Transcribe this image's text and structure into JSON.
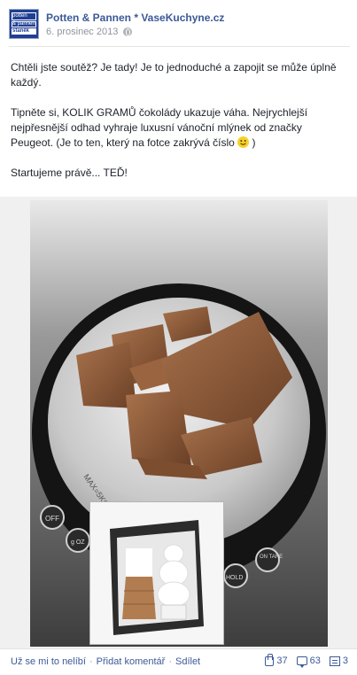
{
  "post": {
    "author": "Potten & Pannen * VaseKuchyne.cz",
    "date": "6. prosinec 2013",
    "privacy_icon": "globe-icon",
    "avatar_text": {
      "line1": "potten",
      "line2": "& pannen",
      "line3": "staněk"
    },
    "paragraphs": [
      "Chtěli jste soutěž? Je tady! Je to jednoduché a zapojit se může úplně každý.",
      "Tipněte si, KOLIK GRAMŮ čokolády ukazuje váha. Nejrychlejší nejpřesnější odhad vyhraje luxusní vánoční mlýnek od značky Peugeot. (Je to ten, který na fotce zakrývá číslo",
      "Startujeme právě... TEĎ!"
    ],
    "paragraph2_tail": " )",
    "smiley_icon": "smiley-icon"
  },
  "photo": {
    "scale_labels": {
      "max": "MAX=5KG",
      "off": "OFF",
      "g_oz": "g OZ",
      "hold": "HOLD",
      "on_tare": "ON TARE"
    }
  },
  "footer": {
    "unlike": "Už se mi to nelíbí",
    "sep1": "·",
    "comment": "Přidat komentář",
    "sep2": "·",
    "share": "Sdílet",
    "likes": "37",
    "comments": "63",
    "shares": "3"
  },
  "colors": {
    "link": "#3b5998",
    "meta": "#90949c",
    "chocolate": "#8a5a3b"
  }
}
